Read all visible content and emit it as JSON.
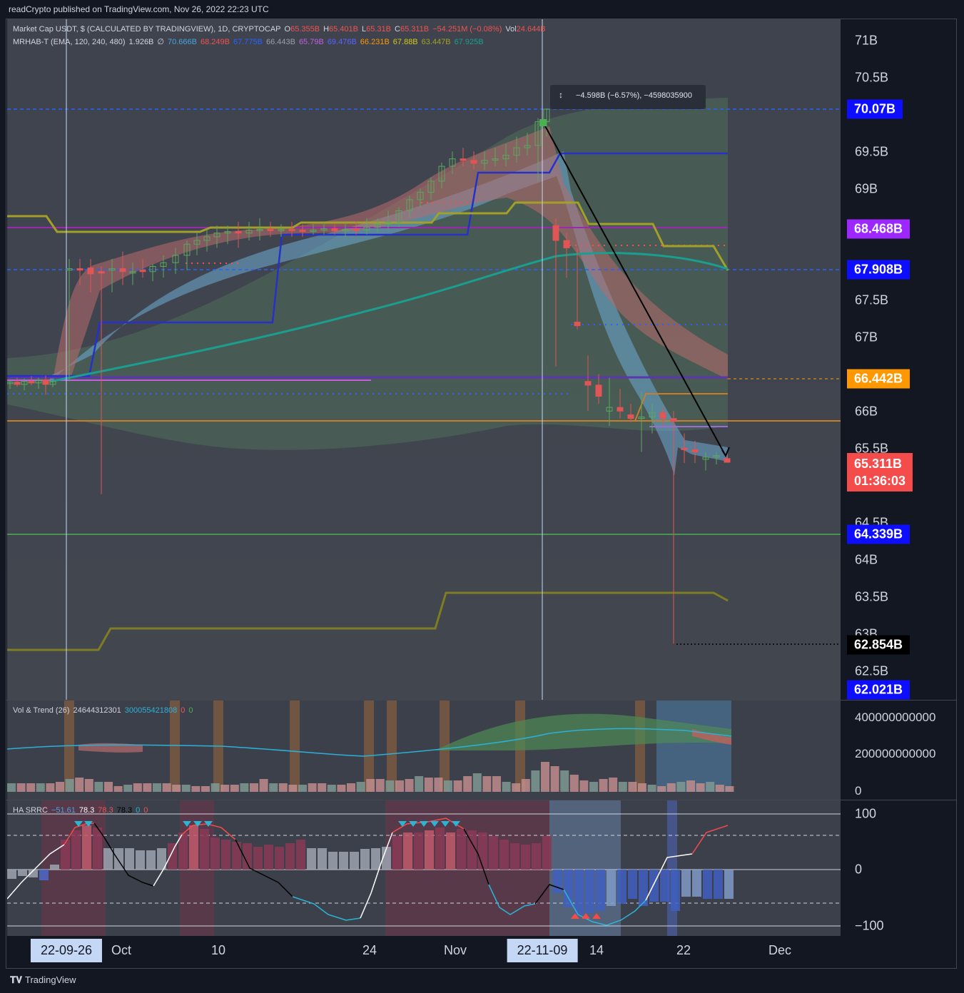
{
  "header": {
    "published": "readCrypto published on TradingView.com, Nov 26, 2022 22:23 UTC"
  },
  "main_legend": {
    "symbol": "Market Cap USDT, $ (CALCULATED BY TRADINGVIEW), 1D, CRYPTOCAP",
    "o_label": "O",
    "o": "65.355B",
    "h_label": "H",
    "h": "65.401B",
    "l_label": "L",
    "l": "65.31B",
    "c_label": "C",
    "c": "65.311B",
    "change": "−54.251M (−0.08%)",
    "vol_label": "Vol",
    "vol": "24.644B"
  },
  "indicator_legend": {
    "name": "MRHAB-T (EMA, 120, 240, 480)",
    "v1": "1.926B",
    "v2": "∅",
    "vals": [
      "70.666B",
      "68.249B",
      "67.775B",
      "66.443B",
      "65.79B",
      "69.476B",
      "66.231B",
      "67.88B",
      "63.447B",
      "67.925B"
    ]
  },
  "tooltip": {
    "text": "−4.598B (−6.57%), −4598035900"
  },
  "price_axis": {
    "ticks": [
      "71B",
      "70.5B",
      "69.5B",
      "69B",
      "67.5B",
      "67B",
      "66B",
      "65.5B",
      "64.5B",
      "64B",
      "63.5B",
      "63B",
      "62.5B"
    ],
    "tags": {
      "t1": "70.07B",
      "t2": "68.468B",
      "t3": "67.908B",
      "t4": "66.442B",
      "t5": "65.311B",
      "t5b": "01:36:03",
      "t6": "64.339B",
      "t7": "62.854B",
      "t8": "62.021B"
    }
  },
  "vol_pane": {
    "legend_name": "Vol & Trend (26)",
    "v1": "24644312301",
    "v2": "300055421808",
    "v3": "0",
    "v4": "0",
    "ticks": [
      "400000000000",
      "200000000000",
      "0"
    ]
  },
  "ha_pane": {
    "legend_name": "HA SRRC",
    "v1": "−51.61",
    "v2": "78.3",
    "v3": "78.3",
    "v4": "78.3",
    "v5": "0",
    "v6": "0",
    "ticks": [
      "100",
      "0",
      "−100"
    ]
  },
  "time_axis": {
    "labels": [
      "Oct",
      "10",
      "24",
      "Nov",
      "14",
      "22",
      "Dec"
    ],
    "cursor_dates": [
      "22-09-26",
      "22-11-09"
    ]
  },
  "footer": {
    "brand": "TradingView"
  },
  "colors": {
    "background": "#131722",
    "pane": "#3c404b",
    "up": "#4caf50",
    "down": "#ef5350",
    "blue_tag": "#0d0dff",
    "purple_tag": "#9c27ff",
    "orange_tag": "#ff9800",
    "red_tag": "#f44b4b"
  }
}
